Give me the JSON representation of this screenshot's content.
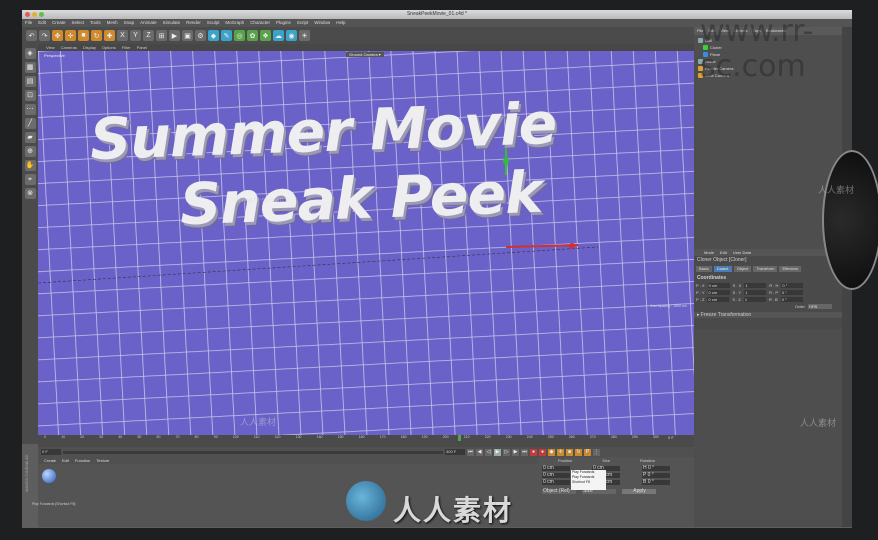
{
  "window": {
    "title": "SneakPeekMovie_01.c4d *"
  },
  "menubar": [
    "File",
    "Edit",
    "Create",
    "Select",
    "Tools",
    "Mesh",
    "Snap",
    "Animate",
    "Simulate",
    "Render",
    "Sculpt",
    "MoGraph",
    "Character",
    "Plugins",
    "Script",
    "Window",
    "Help"
  ],
  "viewport": {
    "menu": [
      "View",
      "Cameras",
      "Display",
      "Options",
      "Filter",
      "Panel"
    ],
    "label": "Perspective",
    "camera": "Ground Camera ▾",
    "grid_info": "Grid Spacing : 1000 cm",
    "title_line1": "Summer Movie",
    "title_line2": "Sneak Peek"
  },
  "objects": {
    "tabs": [
      "File",
      "Edit",
      "View",
      "Objects",
      "Tags",
      "Bookmarks"
    ],
    "items": [
      {
        "name": "Null",
        "color": "#8aa"
      },
      {
        "name": "Cloner",
        "color": "#3ad03a"
      },
      {
        "name": "Plane",
        "color": "#3a8ee0"
      },
      {
        "name": "Guide",
        "color": "#8aa"
      },
      {
        "name": "Render Camera",
        "color": "#e0a030"
      },
      {
        "name": "Orbit Camera",
        "color": "#e0a030"
      }
    ]
  },
  "attributes": {
    "menu": [
      "Mode",
      "Edit",
      "User Data"
    ],
    "object": "Cloner Object [Cloner]",
    "tabs": [
      "Basic",
      "Coord.",
      "Object",
      "Transform",
      "Effectors"
    ],
    "selected_tab": "Coord.",
    "section": "Coordinates",
    "rows": [
      {
        "p": "P . X",
        "pv": "0 cm",
        "s": "S . X",
        "sv": "1",
        "r": "R . H",
        "rv": "0 °"
      },
      {
        "p": "P . Y",
        "pv": "0 cm",
        "s": "S . Y",
        "sv": "1",
        "r": "R . P",
        "rv": "0 °"
      },
      {
        "p": "P . Z",
        "pv": "0 cm",
        "s": "S . Z",
        "sv": "1",
        "r": "R . B",
        "rv": "0 °"
      }
    ],
    "order_label": "Order",
    "order_value": "HPB",
    "freeze": "▸ Freeze Transformation"
  },
  "timeline": {
    "ticks": [
      "0",
      "10",
      "20",
      "30",
      "40",
      "50",
      "60",
      "70",
      "80",
      "90",
      "100",
      "110",
      "120",
      "130",
      "140",
      "150",
      "160",
      "170",
      "180",
      "190",
      "200",
      "210",
      "220",
      "230",
      "240",
      "250",
      "260",
      "270",
      "280",
      "290",
      "300"
    ],
    "current_frame": "0 F",
    "end_frame": "300 F"
  },
  "materials": {
    "menu": [
      "Create",
      "Edit",
      "Function",
      "Texture"
    ]
  },
  "coords": {
    "headers": [
      "Position",
      "Size",
      "Rotation"
    ],
    "values": [
      "0 cm",
      "0 cm",
      "H  0 °",
      "0 cm",
      "1730 cm",
      "P  0 °",
      "0 cm",
      "3600 cm",
      "B  0 °"
    ],
    "mode1": "Object (Rel)",
    "mode2": "Size",
    "apply": "Apply"
  },
  "tooltip": {
    "lines": [
      "Play Forwards",
      "Play Forwards",
      "Shortcut F8"
    ]
  },
  "status": "Play Forwards [Shortcut F8]",
  "watermarks": {
    "url": "www.rr-sc.com",
    "cn": "人人素材",
    "small": "人人素材"
  }
}
